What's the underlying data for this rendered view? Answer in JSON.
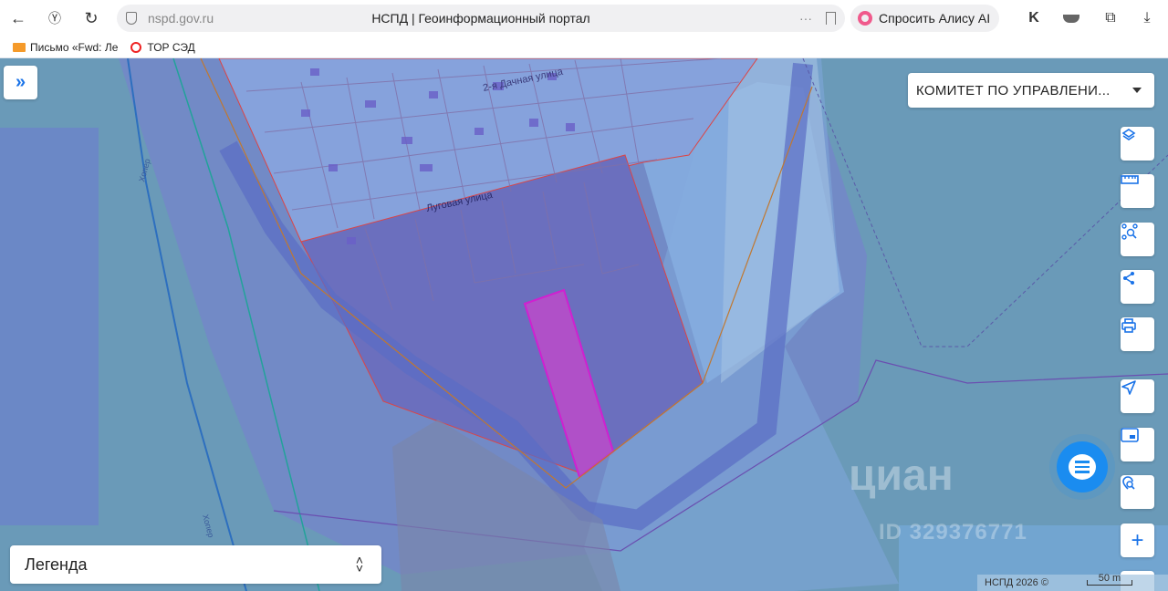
{
  "browser": {
    "url": "nspd.gov.ru",
    "page_title": "НСПД | Геоинформационный портал",
    "alice_label": "Спросить Алису AI",
    "more": "···",
    "bookmarks": [
      {
        "label": "Письмо «Fwd: Ле"
      },
      {
        "label": "ТОР СЭД"
      }
    ]
  },
  "map": {
    "org_select": "КОМИТЕТ ПО УПРАВЛЕНИ...",
    "legend_label": "Легенда",
    "streets": [
      "2-я Дачная улица",
      "Луговая улица",
      "Хопер",
      "Хопер"
    ],
    "watermark": "циан",
    "watermark_id": "ID 329376771",
    "copyright": "НСПД 2026 ©",
    "scale": "50 m",
    "zoom_in": "+"
  },
  "colors": {
    "accent": "#1a73e8",
    "highlight_parcel": "#c030c0"
  }
}
